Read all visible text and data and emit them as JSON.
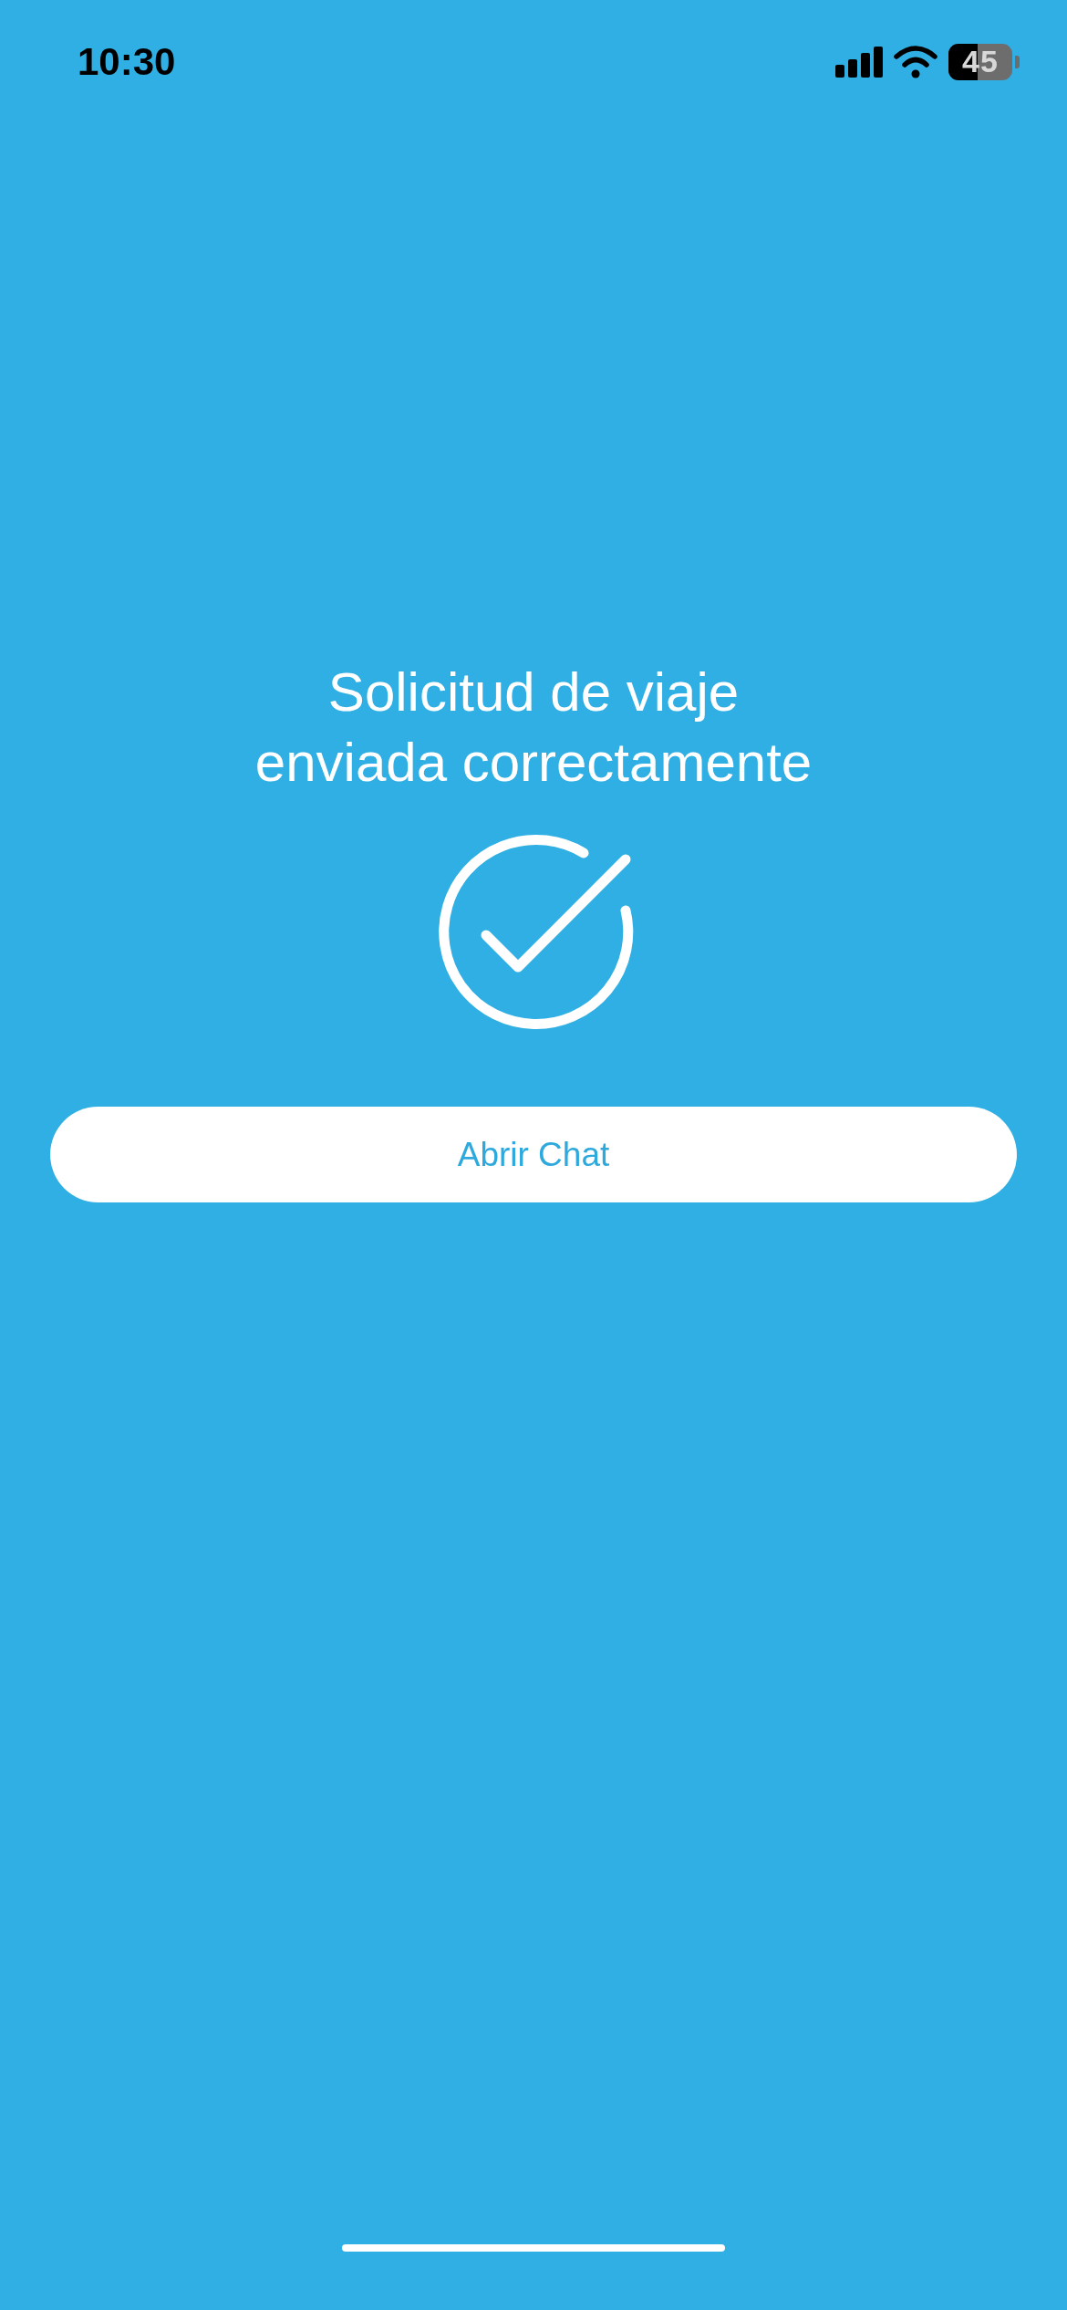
{
  "status_bar": {
    "time": "10:30",
    "battery": "45"
  },
  "message": {
    "lines": [
      "Solicitud de viaje",
      "enviada correctamente"
    ]
  },
  "button": {
    "label": "Abrir Chat"
  }
}
